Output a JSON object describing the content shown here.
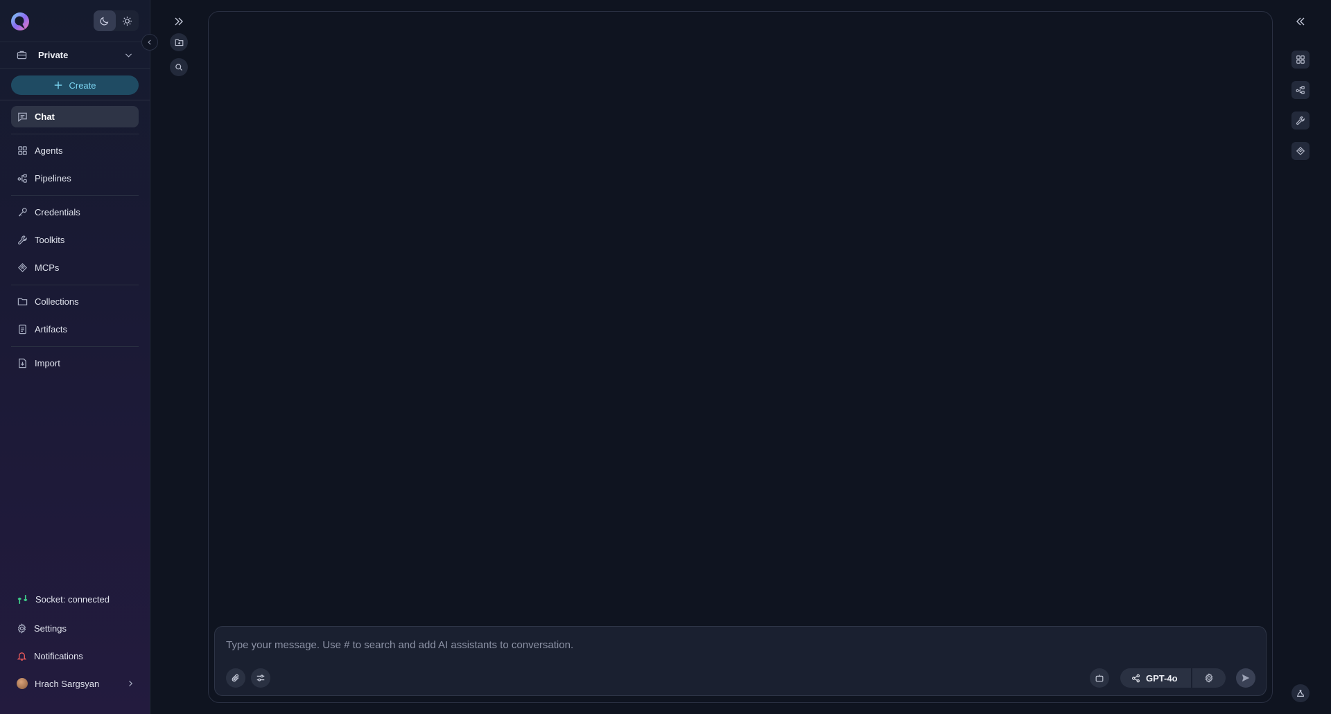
{
  "workspace": {
    "name": "Private"
  },
  "create_label": "Create",
  "nav": {
    "chat": "Chat",
    "agents": "Agents",
    "pipelines": "Pipelines",
    "credentials": "Credentials",
    "toolkits": "Toolkits",
    "mcps": "MCPs",
    "collections": "Collections",
    "artifacts": "Artifacts",
    "import": "Import"
  },
  "footer": {
    "socket_status": "Socket: connected",
    "settings": "Settings",
    "notifications": "Notifications",
    "user_name": "Hrach Sargsyan"
  },
  "chat": {
    "placeholder": "Type your message. Use # to search and add AI assistants to conversation.",
    "value": "",
    "model": "GPT-4o"
  },
  "colors": {
    "accent": "#7ad3f0",
    "socket_ok": "#3fd08a",
    "notification": "#ef5b5b"
  },
  "icons": {
    "left_rail": [
      "expand-chevrons-icon",
      "new-folder-icon",
      "search-icon"
    ],
    "right_rail": [
      "collapse-chevrons-icon",
      "agents-grid-icon",
      "pipelines-icon",
      "toolkits-icon",
      "mcps-icon",
      "assistant-icon"
    ]
  }
}
